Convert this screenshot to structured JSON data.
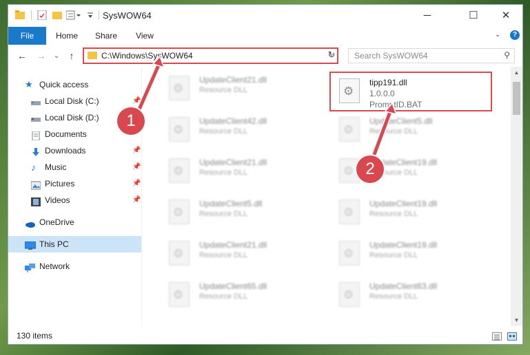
{
  "window": {
    "title": "SysWOW64"
  },
  "ribbon": {
    "tabs": [
      "File",
      "Home",
      "Share",
      "View"
    ],
    "help_label": "?"
  },
  "nav": {
    "back_glyph": "←",
    "forward_glyph": "→",
    "recent_glyph": "⌄",
    "up_glyph": "↑",
    "address": "C:\\Windows\\SysWOW64",
    "search_placeholder": "Search SysWOW64"
  },
  "sidebar": {
    "items": [
      {
        "label": "Quick access",
        "icon": "star-icon",
        "pinned": false
      },
      {
        "label": "Local Disk (C:)",
        "icon": "drive-icon",
        "pinned": true
      },
      {
        "label": "Local Disk (D:)",
        "icon": "drive-icon",
        "pinned": false
      },
      {
        "label": "Documents",
        "icon": "documents-icon",
        "pinned": false
      },
      {
        "label": "Downloads",
        "icon": "download-icon",
        "pinned": true
      },
      {
        "label": "Music",
        "icon": "music-icon",
        "pinned": true
      },
      {
        "label": "Pictures",
        "icon": "pictures-icon",
        "pinned": true
      },
      {
        "label": "Videos",
        "icon": "videos-icon",
        "pinned": true
      },
      {
        "label": "OneDrive",
        "icon": "cloud-icon",
        "pinned": false
      },
      {
        "label": "This PC",
        "icon": "computer-icon",
        "pinned": false,
        "selected": true
      },
      {
        "label": "Network",
        "icon": "network-icon",
        "pinned": false
      }
    ]
  },
  "files": {
    "left_column": [
      {
        "name": "UpdateClient21.dll",
        "type": "Resource DLL"
      },
      {
        "name": "UpdateClient42.dll",
        "type": "Resource DLL"
      },
      {
        "name": "UpdateClient21.dll",
        "type": "Resource DLL"
      },
      {
        "name": "UpdateClient5.dll",
        "type": "Resource DLL"
      },
      {
        "name": "UpdateClient21.dll",
        "type": "Resource DLL"
      },
      {
        "name": "UpdateClient65.dll",
        "type": "Resource DLL"
      }
    ],
    "right_column": [
      {
        "name": "UpdateClient5.dll",
        "type": "Resource DLL"
      },
      {
        "name": "UpdateClient19.dll",
        "type": "Resource DLL"
      },
      {
        "name": "UpdateClient19.dll",
        "type": "Resource DLL"
      },
      {
        "name": "UpdateClient19.dll",
        "type": "Resource DLL"
      },
      {
        "name": "UpdateClient63.dll",
        "type": "Resource DLL"
      }
    ],
    "highlighted": {
      "name": "tipp191.dll",
      "version": "1.0.0.0",
      "company": "PromptID.BAT"
    }
  },
  "status": {
    "item_count": "130 items"
  },
  "annotations": {
    "step1": "1",
    "step2": "2"
  },
  "colors": {
    "accent": "#1979ca",
    "annotation": "#d9484e",
    "selected": "#cce4f7"
  }
}
